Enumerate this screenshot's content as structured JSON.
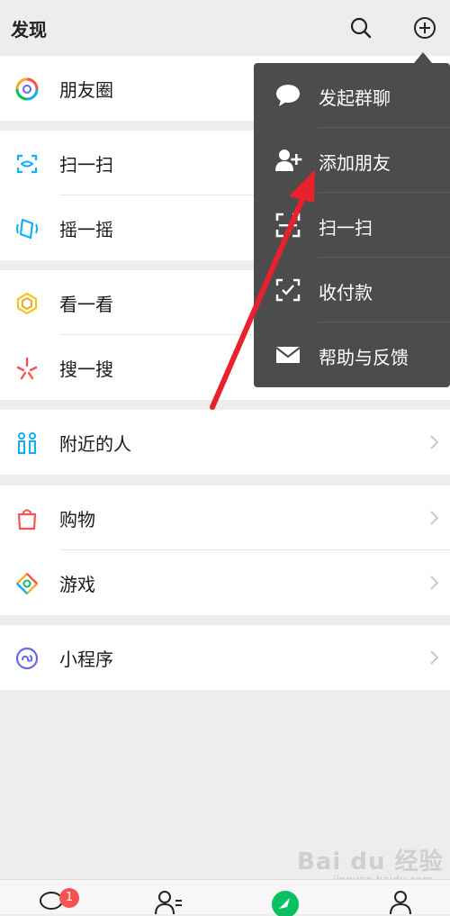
{
  "header": {
    "title": "发现"
  },
  "groups": [
    {
      "items": [
        {
          "label": "朋友圈",
          "icon": "moments-icon"
        }
      ]
    },
    {
      "items": [
        {
          "label": "扫一扫",
          "icon": "scan-icon"
        },
        {
          "label": "摇一摇",
          "icon": "shake-icon"
        }
      ]
    },
    {
      "items": [
        {
          "label": "看一看",
          "icon": "top-stories-icon"
        },
        {
          "label": "搜一搜",
          "icon": "search-icon"
        }
      ]
    },
    {
      "items": [
        {
          "label": "附近的人",
          "icon": "people-nearby-icon"
        }
      ]
    },
    {
      "items": [
        {
          "label": "购物",
          "icon": "shopping-icon"
        },
        {
          "label": "游戏",
          "icon": "games-icon"
        }
      ]
    },
    {
      "items": [
        {
          "label": "小程序",
          "icon": "mini-program-icon"
        }
      ]
    }
  ],
  "menu": {
    "items": [
      {
        "label": "发起群聊",
        "icon": "chat-bubble-icon"
      },
      {
        "label": "添加朋友",
        "icon": "add-friend-icon"
      },
      {
        "label": "扫一扫",
        "icon": "scan-icon"
      },
      {
        "label": "收付款",
        "icon": "payment-icon"
      },
      {
        "label": "帮助与反馈",
        "icon": "envelope-icon"
      }
    ]
  },
  "tabbar": {
    "chats_badge": "1"
  },
  "watermark": {
    "main": "Bai du 经验",
    "sub": "jingyan.baidu.com"
  },
  "colors": {
    "background": "#ededed",
    "menu_bg": "#4c4c4c",
    "badge": "#fa5151",
    "arrow": "#e8212d",
    "accent_green": "#07c160"
  }
}
